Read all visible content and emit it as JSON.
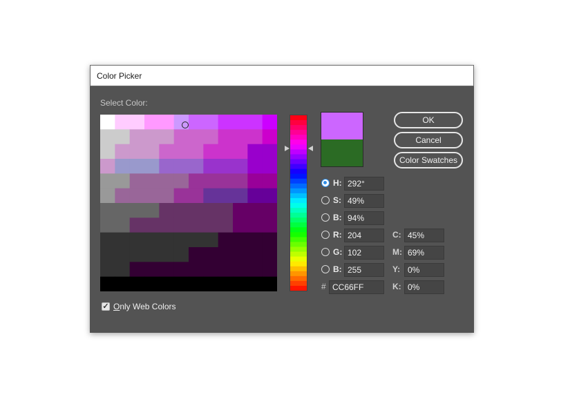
{
  "window": {
    "title": "Color Picker"
  },
  "picker": {
    "select_label": "Select Color:",
    "new_color": "#cc66ff",
    "old_color": "#2b6b24"
  },
  "buttons": {
    "ok": "OK",
    "cancel": "Cancel",
    "swatches": "Color Swatches"
  },
  "hsb": [
    {
      "label": "H:",
      "value": "292°",
      "checked": true
    },
    {
      "label": "S:",
      "value": "49%",
      "checked": false
    },
    {
      "label": "B:",
      "value": "94%",
      "checked": false
    }
  ],
  "rgb": [
    {
      "label": "R:",
      "value": "204",
      "checked": false
    },
    {
      "label": "G:",
      "value": "102",
      "checked": false
    },
    {
      "label": "B:",
      "value": "255",
      "checked": false
    }
  ],
  "hex": {
    "label": "#",
    "value": "CC66FF"
  },
  "cmyk": [
    {
      "label": "C:",
      "value": "45%"
    },
    {
      "label": "M:",
      "value": "69%"
    },
    {
      "label": "Y:",
      "value": "0%"
    },
    {
      "label": "K:",
      "value": "0%"
    }
  ],
  "web_colors": {
    "label_underlined": "O",
    "label_rest": "nly Web Colors",
    "checked": true
  }
}
